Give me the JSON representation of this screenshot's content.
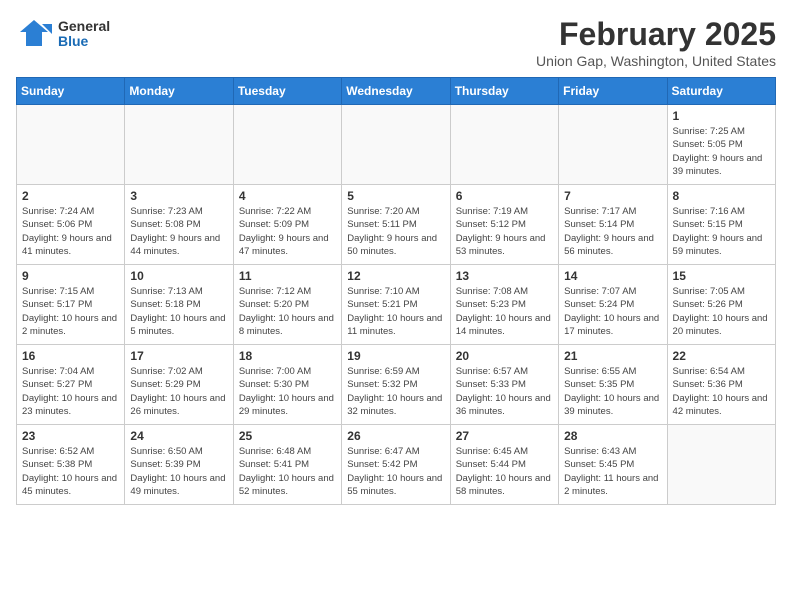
{
  "header": {
    "logo_general": "General",
    "logo_blue": "Blue",
    "month_title": "February 2025",
    "location": "Union Gap, Washington, United States"
  },
  "weekdays": [
    "Sunday",
    "Monday",
    "Tuesday",
    "Wednesday",
    "Thursday",
    "Friday",
    "Saturday"
  ],
  "weeks": [
    [
      {
        "day": "",
        "info": ""
      },
      {
        "day": "",
        "info": ""
      },
      {
        "day": "",
        "info": ""
      },
      {
        "day": "",
        "info": ""
      },
      {
        "day": "",
        "info": ""
      },
      {
        "day": "",
        "info": ""
      },
      {
        "day": "1",
        "info": "Sunrise: 7:25 AM\nSunset: 5:05 PM\nDaylight: 9 hours and 39 minutes."
      }
    ],
    [
      {
        "day": "2",
        "info": "Sunrise: 7:24 AM\nSunset: 5:06 PM\nDaylight: 9 hours and 41 minutes."
      },
      {
        "day": "3",
        "info": "Sunrise: 7:23 AM\nSunset: 5:08 PM\nDaylight: 9 hours and 44 minutes."
      },
      {
        "day": "4",
        "info": "Sunrise: 7:22 AM\nSunset: 5:09 PM\nDaylight: 9 hours and 47 minutes."
      },
      {
        "day": "5",
        "info": "Sunrise: 7:20 AM\nSunset: 5:11 PM\nDaylight: 9 hours and 50 minutes."
      },
      {
        "day": "6",
        "info": "Sunrise: 7:19 AM\nSunset: 5:12 PM\nDaylight: 9 hours and 53 minutes."
      },
      {
        "day": "7",
        "info": "Sunrise: 7:17 AM\nSunset: 5:14 PM\nDaylight: 9 hours and 56 minutes."
      },
      {
        "day": "8",
        "info": "Sunrise: 7:16 AM\nSunset: 5:15 PM\nDaylight: 9 hours and 59 minutes."
      }
    ],
    [
      {
        "day": "9",
        "info": "Sunrise: 7:15 AM\nSunset: 5:17 PM\nDaylight: 10 hours and 2 minutes."
      },
      {
        "day": "10",
        "info": "Sunrise: 7:13 AM\nSunset: 5:18 PM\nDaylight: 10 hours and 5 minutes."
      },
      {
        "day": "11",
        "info": "Sunrise: 7:12 AM\nSunset: 5:20 PM\nDaylight: 10 hours and 8 minutes."
      },
      {
        "day": "12",
        "info": "Sunrise: 7:10 AM\nSunset: 5:21 PM\nDaylight: 10 hours and 11 minutes."
      },
      {
        "day": "13",
        "info": "Sunrise: 7:08 AM\nSunset: 5:23 PM\nDaylight: 10 hours and 14 minutes."
      },
      {
        "day": "14",
        "info": "Sunrise: 7:07 AM\nSunset: 5:24 PM\nDaylight: 10 hours and 17 minutes."
      },
      {
        "day": "15",
        "info": "Sunrise: 7:05 AM\nSunset: 5:26 PM\nDaylight: 10 hours and 20 minutes."
      }
    ],
    [
      {
        "day": "16",
        "info": "Sunrise: 7:04 AM\nSunset: 5:27 PM\nDaylight: 10 hours and 23 minutes."
      },
      {
        "day": "17",
        "info": "Sunrise: 7:02 AM\nSunset: 5:29 PM\nDaylight: 10 hours and 26 minutes."
      },
      {
        "day": "18",
        "info": "Sunrise: 7:00 AM\nSunset: 5:30 PM\nDaylight: 10 hours and 29 minutes."
      },
      {
        "day": "19",
        "info": "Sunrise: 6:59 AM\nSunset: 5:32 PM\nDaylight: 10 hours and 32 minutes."
      },
      {
        "day": "20",
        "info": "Sunrise: 6:57 AM\nSunset: 5:33 PM\nDaylight: 10 hours and 36 minutes."
      },
      {
        "day": "21",
        "info": "Sunrise: 6:55 AM\nSunset: 5:35 PM\nDaylight: 10 hours and 39 minutes."
      },
      {
        "day": "22",
        "info": "Sunrise: 6:54 AM\nSunset: 5:36 PM\nDaylight: 10 hours and 42 minutes."
      }
    ],
    [
      {
        "day": "23",
        "info": "Sunrise: 6:52 AM\nSunset: 5:38 PM\nDaylight: 10 hours and 45 minutes."
      },
      {
        "day": "24",
        "info": "Sunrise: 6:50 AM\nSunset: 5:39 PM\nDaylight: 10 hours and 49 minutes."
      },
      {
        "day": "25",
        "info": "Sunrise: 6:48 AM\nSunset: 5:41 PM\nDaylight: 10 hours and 52 minutes."
      },
      {
        "day": "26",
        "info": "Sunrise: 6:47 AM\nSunset: 5:42 PM\nDaylight: 10 hours and 55 minutes."
      },
      {
        "day": "27",
        "info": "Sunrise: 6:45 AM\nSunset: 5:44 PM\nDaylight: 10 hours and 58 minutes."
      },
      {
        "day": "28",
        "info": "Sunrise: 6:43 AM\nSunset: 5:45 PM\nDaylight: 11 hours and 2 minutes."
      },
      {
        "day": "",
        "info": ""
      }
    ]
  ]
}
